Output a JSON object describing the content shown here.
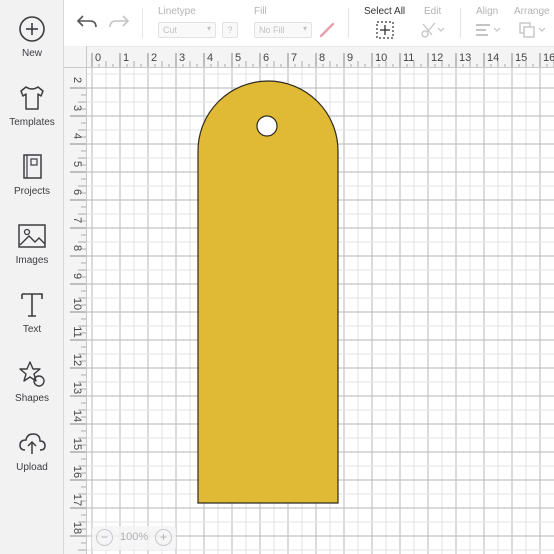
{
  "sidebar": {
    "items": [
      {
        "label": "New",
        "icon": "plus-circle-icon"
      },
      {
        "label": "Templates",
        "icon": "tshirt-icon"
      },
      {
        "label": "Projects",
        "icon": "notebook-icon"
      },
      {
        "label": "Images",
        "icon": "image-icon"
      },
      {
        "label": "Text",
        "icon": "text-t-icon"
      },
      {
        "label": "Shapes",
        "icon": "shapes-icon"
      },
      {
        "label": "Upload",
        "icon": "cloud-upload-icon"
      }
    ]
  },
  "toolbar": {
    "undo_icon": "undo-icon",
    "redo_icon": "redo-icon",
    "linetype_label": "Linetype",
    "linetype_value": "Cut",
    "help_label": "?",
    "fill_label": "Fill",
    "fill_value": "No Fill",
    "select_all_label": "Select All",
    "edit_label": "Edit",
    "align_label": "Align",
    "arrange_label": "Arrange"
  },
  "ruler": {
    "horizontal": [
      "0",
      "1",
      "2",
      "3",
      "4",
      "5",
      "6",
      "7",
      "8",
      "9",
      "10",
      "11",
      "12",
      "13",
      "14",
      "15",
      "16"
    ],
    "vertical": [
      "2",
      "3",
      "4",
      "5",
      "6",
      "7",
      "8",
      "9",
      "10",
      "11",
      "12",
      "13",
      "14",
      "15",
      "16",
      "17",
      "18"
    ]
  },
  "canvas": {
    "shape_name": "tag-shape",
    "shape_color": "#e0b935",
    "grid_color": "#cfcfd3"
  },
  "zoom": {
    "minus": "−",
    "value": "100%",
    "plus": "+"
  },
  "colors": {
    "sidebar_bg": "#f2f2f3",
    "icon_color": "#3c3c40",
    "disabled_text": "#b4b4b8"
  }
}
